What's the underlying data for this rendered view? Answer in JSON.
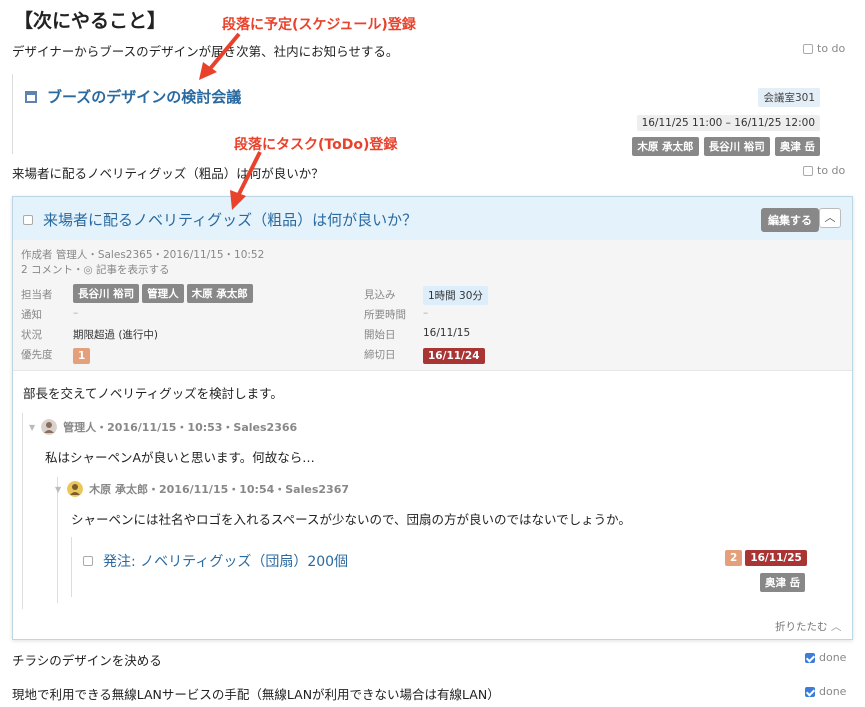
{
  "heading": "【次にやること】",
  "paragraphs": {
    "p1": "デザイナーからブースのデザインが届き次第、社内にお知らせする。",
    "p2": "来場者に配るノベリティグッズ（粗品）は何が良いか？",
    "p3": "チラシのデザインを決める",
    "p4": "現地で利用できる無線LANサービスの手配（無線LANが利用できない場合は有線LAN）"
  },
  "todo_label": "to do",
  "done_label": "done",
  "annotations": {
    "a1": "段落に予定(スケジュール)登録",
    "a2": "段落にタスク(ToDo)登録"
  },
  "event": {
    "title": "ブーズのデザインの検討会議",
    "room": "会議室301",
    "datetime": "16/11/25 11:00 – 16/11/25 12:00",
    "attendees": [
      "木原 承太郎",
      "長谷川 裕司",
      "奥津 岳"
    ]
  },
  "task": {
    "title": "来場者に配るノベリティグッズ（粗品）は何が良いか？",
    "edit_label": "編集する",
    "author_line": "作成者 管理人・Sales2365・2016/11/15・10:52",
    "comments_line": "2 コメント・◎ 記事を表示する",
    "fields": {
      "assignee_label": "担当者",
      "assignees": [
        "長谷川 裕司",
        "管理人",
        "木原 承太郎"
      ],
      "notify_label": "通知",
      "notify_value": "–",
      "status_label": "状況",
      "status_value": "期限超過 (進行中)",
      "priority_label": "優先度",
      "priority_value": "1",
      "estimate_label": "見込み",
      "estimate_value": "1時間 30分",
      "elapsed_label": "所要時間",
      "elapsed_value": "–",
      "start_label": "開始日",
      "start_value": "16/11/15",
      "due_label": "締切日",
      "due_value": "16/11/24"
    },
    "body": "部長を交えてノベリティグッズを検討します。",
    "comments": [
      {
        "meta": "管理人・2016/11/15・10:53・Sales2366",
        "text": "私はシャーペンAが良いと思います。何故なら…"
      },
      {
        "meta": "木原 承太郎・2016/11/15・10:54・Sales2367",
        "text": "シャーペンには社名やロゴを入れるスペースが少ないので、団扇の方が良いのではないでしょうか。"
      }
    ],
    "subtask": {
      "title": "発注: ノベリティグッズ（団扇）200個",
      "priority": "2",
      "due": "16/11/25",
      "assignee": "奥津 岳"
    },
    "fold_label": "折りたたむ"
  },
  "colors": {
    "link": "#2a6aa0",
    "annotation": "#e8422c",
    "overdue": "#a93434",
    "header_bg": "#e4f2fb"
  }
}
